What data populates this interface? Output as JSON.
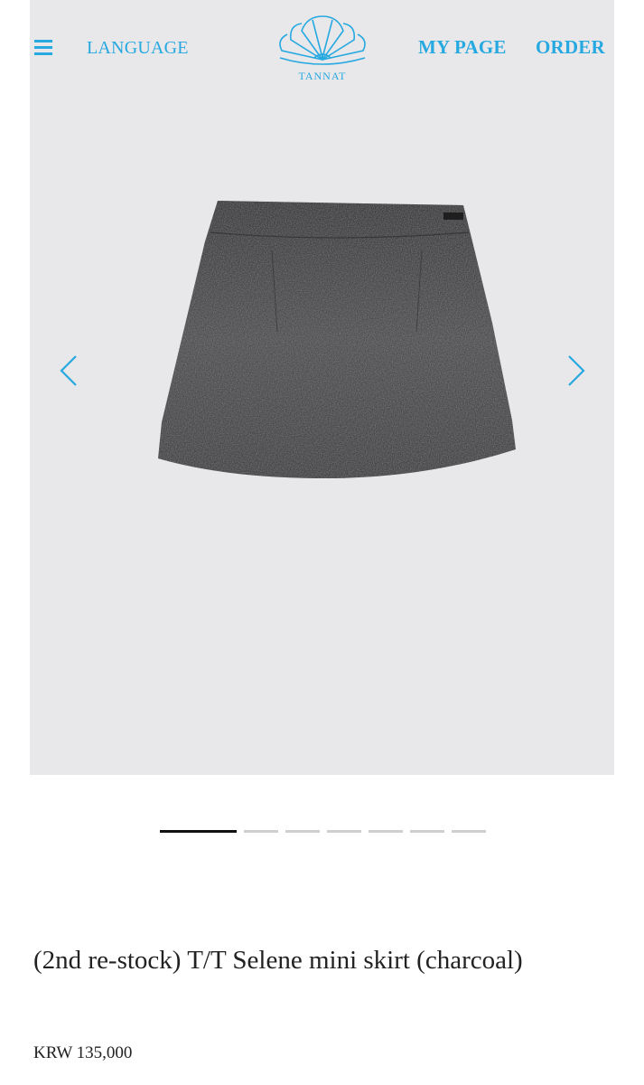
{
  "header": {
    "language_label": "LANGUAGE",
    "mypage_label": "MY PAGE",
    "order_label": "ORDER",
    "logo_text": "TANNAT",
    "menu_icon": "hamburger-menu-icon",
    "logo_icon": "shell-logo-icon"
  },
  "gallery": {
    "image_subject": "grey tweed mini skirt",
    "prev_icon": "chevron-left-icon",
    "next_icon": "chevron-right-icon",
    "slide_count": 7,
    "active_slide": 1
  },
  "product": {
    "title": "(2nd re-stock) T/T Selene mini skirt (charcoal)",
    "price": "KRW 135,000"
  },
  "colors": {
    "accent": "#26a9e0",
    "hero_bg": "#e8e7ea",
    "text": "#222222"
  }
}
